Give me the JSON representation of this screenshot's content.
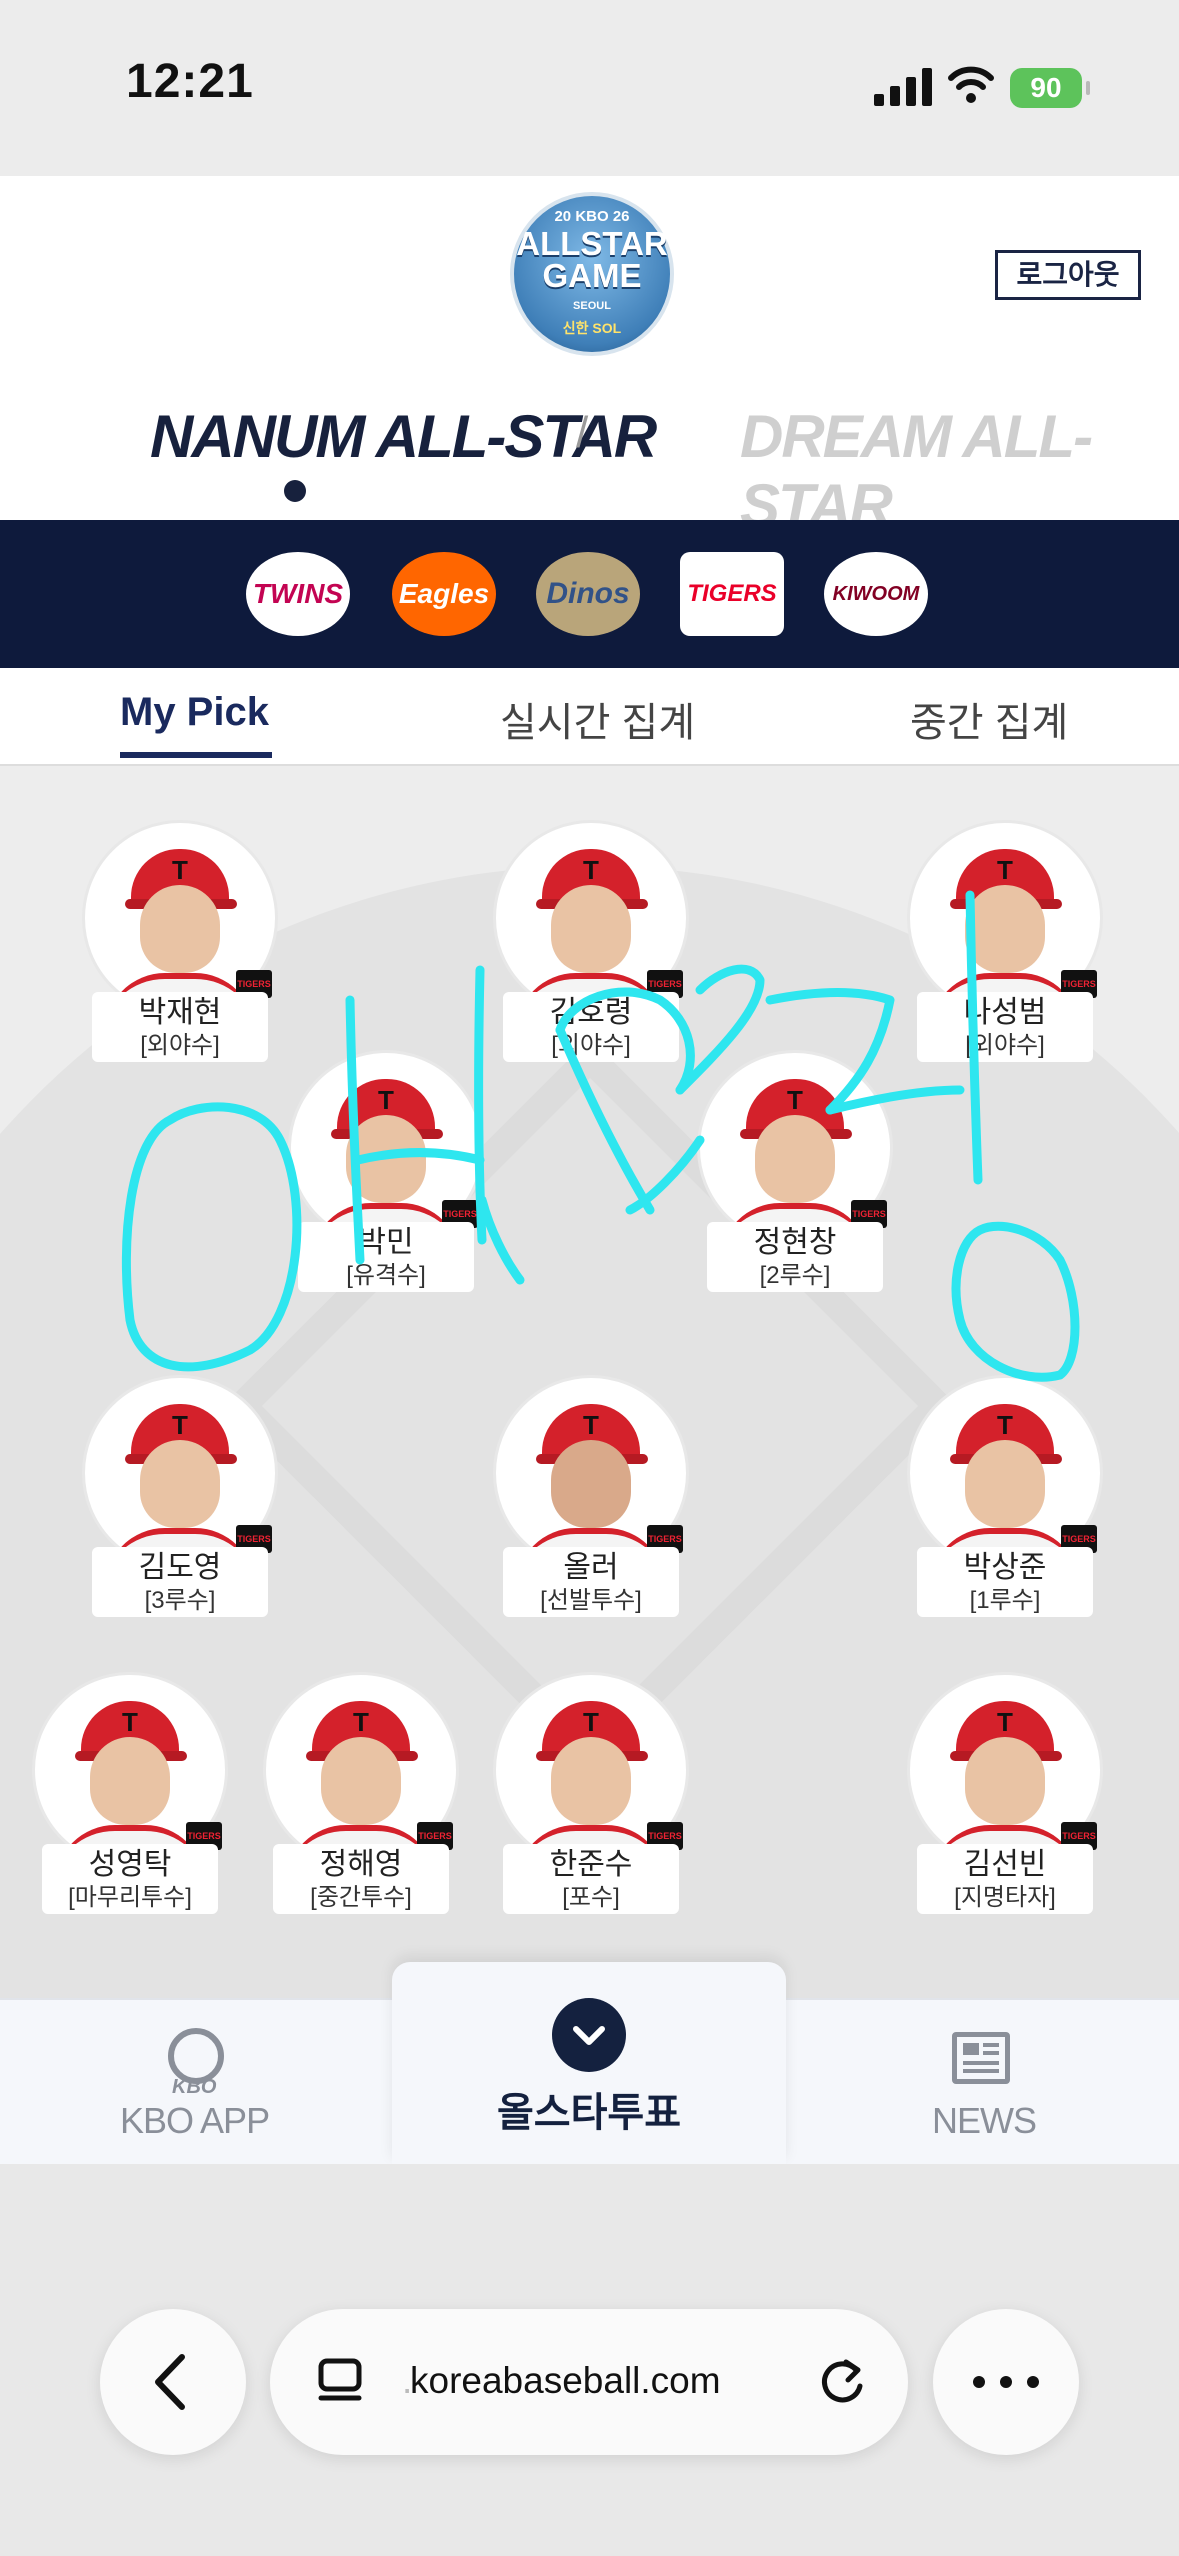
{
  "status_bar": {
    "time": "12:21",
    "battery": "90"
  },
  "header": {
    "emblem": {
      "top_text": "20 KBO 26",
      "title": "ALLSTAR GAME",
      "city": "SEOUL",
      "sponsor": "신한 SOL"
    },
    "logout_label": "로그아웃",
    "league_left": "NANUM ALL-STAR",
    "league_right": "DREAM ALL-STAR"
  },
  "teams": [
    {
      "name": "TWINS",
      "color": "#c30452"
    },
    {
      "name": "Eagles",
      "color": "#ff6600"
    },
    {
      "name": "Dinos",
      "color": "#315288"
    },
    {
      "name": "TIGERS",
      "color": "#ea0029"
    },
    {
      "name": "KIWOOM",
      "color": "#820024"
    }
  ],
  "tabs": [
    {
      "label": "My Pick",
      "active": true
    },
    {
      "label": "실시간 집계",
      "active": false
    },
    {
      "label": "중간 집계",
      "active": false
    }
  ],
  "players": [
    {
      "name": "박재현",
      "position": "[외야수]"
    },
    {
      "name": "김호령",
      "position": "[외야수]"
    },
    {
      "name": "나성범",
      "position": "[외야수]"
    },
    {
      "name": "박민",
      "position": "[유격수]"
    },
    {
      "name": "정현창",
      "position": "[2루수]"
    },
    {
      "name": "김도영",
      "position": "[3루수]"
    },
    {
      "name": "올러",
      "position": "[선발투수]"
    },
    {
      "name": "박상준",
      "position": "[1루수]"
    },
    {
      "name": "성영탁",
      "position": "[마무리투수]"
    },
    {
      "name": "정해영",
      "position": "[중간투수]"
    },
    {
      "name": "한준수",
      "position": "[포수]"
    },
    {
      "name": "김선빈",
      "position": "[지명타자]"
    }
  ],
  "team_badge": "TIGERS",
  "bottom_nav": {
    "left_small": "KBO",
    "left": "KBO APP",
    "center": "올스타투표",
    "right": "NEWS"
  },
  "browser": {
    "url": "koreabaseball.com",
    "url_prefix": "."
  },
  "colors": {
    "navy": "#0e1a3c",
    "active_tab": "#1a2a5e",
    "battery": "#5dc35b",
    "scribble": "#2ee6ef"
  }
}
